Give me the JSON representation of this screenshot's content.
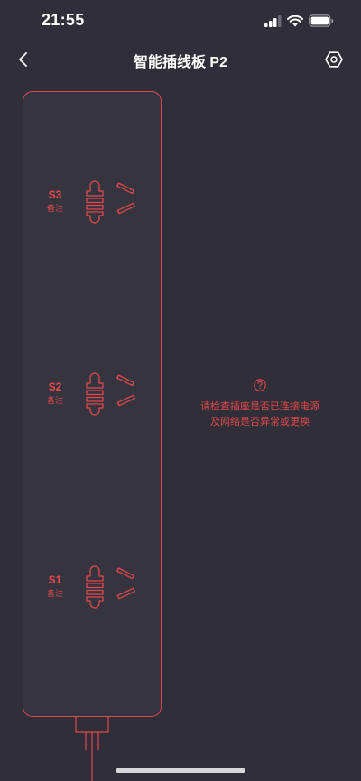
{
  "status_bar": {
    "time": "21:55",
    "icons": [
      "cellular-signal-icon",
      "wifi-icon",
      "battery-icon"
    ]
  },
  "nav": {
    "title": "智能插线板 P2",
    "back_icon": "chevron-left-icon",
    "settings_icon": "settings-hexagon-icon"
  },
  "sockets": [
    {
      "name": "S3",
      "note": "备注"
    },
    {
      "name": "S2",
      "note": "备注"
    },
    {
      "name": "S1",
      "note": "备注"
    }
  ],
  "alert": {
    "icon": "question-circle-icon",
    "line1": "请检查插座是否已连接电源",
    "line2": "及网络是否异常或更换"
  },
  "colors": {
    "background": "#302e38",
    "accent": "#e0494c",
    "text_primary": "#ffffff"
  }
}
